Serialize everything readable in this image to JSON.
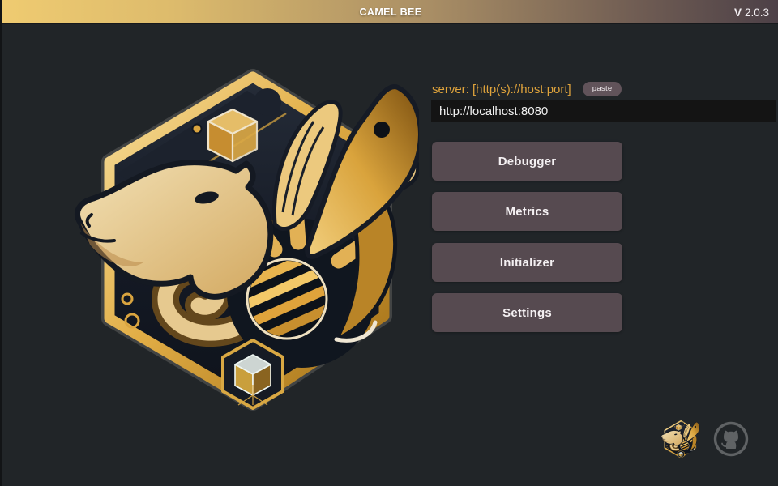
{
  "titlebar": {
    "title": "CAMEL BEE",
    "version_prefix": "V",
    "version": "2.0.3"
  },
  "server": {
    "label": "server: [http(s)://host:port]",
    "paste_button": "paste",
    "url_value": "http://localhost:8080"
  },
  "menu": {
    "buttons": [
      "Debugger",
      "Metrics",
      "Initializer",
      "Settings"
    ]
  },
  "icons": {
    "main_logo": "camel-bee-hexagon-badge",
    "footer_logo": "camel-bee-mini-badge",
    "github": "github-octocat"
  },
  "colors": {
    "background": "#212528",
    "titlebar_gradient_start": "#efcb71",
    "titlebar_gradient_end": "#4c4047",
    "accent_gold": "#e0a43c",
    "button_bg": "#564a50",
    "paste_bg": "#61535a",
    "input_bg": "#141414",
    "github_gray": "#5f6264"
  }
}
